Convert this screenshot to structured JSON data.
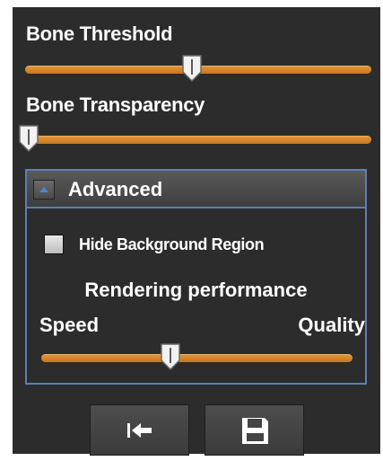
{
  "bone_threshold": {
    "label": "Bone Threshold",
    "value_fraction": 0.48
  },
  "bone_transparency": {
    "label": "Bone Transparency",
    "value_fraction": 0.0
  },
  "advanced": {
    "title": "Advanced",
    "expanded": true,
    "hide_background": {
      "label": "Hide Background Region",
      "checked": false
    },
    "rendering": {
      "title": "Rendering performance",
      "min_label": "Speed",
      "max_label": "Quality",
      "value_fraction": 0.41
    }
  },
  "toolbar": {
    "reset_icon": "jump-to-start-icon",
    "save_icon": "save-disk-icon"
  },
  "colors": {
    "panel_bg": "#2c2c2c",
    "slider_track": "#d98a2c",
    "group_border": "#5b7fb8",
    "collapse_arrow": "#4f86d6"
  }
}
